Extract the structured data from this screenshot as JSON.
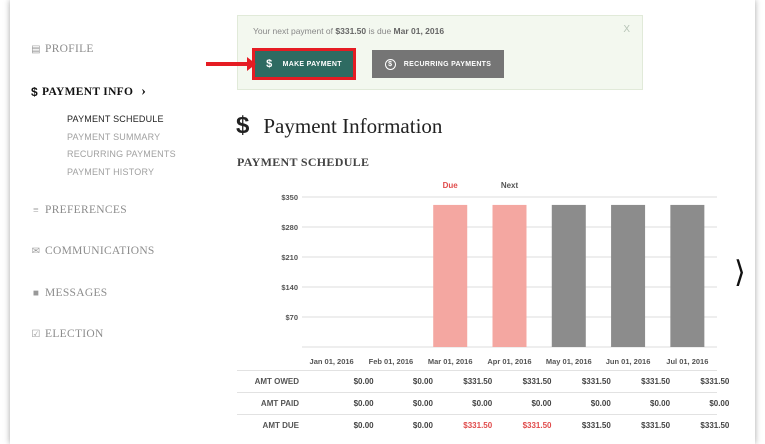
{
  "sidebar": {
    "items": [
      {
        "label": "PROFILE",
        "icon": "id-card-icon"
      },
      {
        "label": "PAYMENT INFO",
        "icon": "dollar-icon"
      },
      {
        "label": "PREFERENCES",
        "icon": "sliders-icon"
      },
      {
        "label": "COMMUNICATIONS",
        "icon": "envelope-icon"
      },
      {
        "label": "MESSAGES",
        "icon": "chat-icon"
      },
      {
        "label": "ELECTION",
        "icon": "checkbox-icon"
      }
    ],
    "subitems": [
      "PAYMENT SCHEDULE",
      "PAYMENT SUMMARY",
      "RECURRING PAYMENTS",
      "PAYMENT HISTORY"
    ]
  },
  "banner": {
    "text_prefix": "Your next payment of ",
    "amount": "$331.50",
    "text_mid": " is due ",
    "due_date": "Mar 01, 2016",
    "close": "X",
    "make_payment": "MAKE PAYMENT",
    "recurring": "RECURRING PAYMENTS"
  },
  "page": {
    "title": "Payment Information",
    "section": "PAYMENT SCHEDULE"
  },
  "colors": {
    "accent": "#2e6b62",
    "highlight": "#e51c23",
    "due_bar": "#f4a7a1",
    "future_bar": "#8c8c8c",
    "due_text": "#e04b4b"
  },
  "chart_data": {
    "type": "bar",
    "categories": [
      "Jan 01, 2016",
      "Feb 01, 2016",
      "Mar 01, 2016",
      "Apr 01, 2016",
      "May 01, 2016",
      "Jun 01, 2016",
      "Jul 01, 2016"
    ],
    "values": [
      0,
      0,
      331.5,
      331.5,
      331.5,
      331.5,
      331.5
    ],
    "status": [
      "",
      "",
      "due",
      "due",
      "future",
      "future",
      "future"
    ],
    "markers": {
      "2": "Due",
      "3": "Next"
    },
    "yticks": [
      "$350",
      "$280",
      "$210",
      "$140",
      "$70"
    ],
    "ytick_values": [
      350,
      280,
      210,
      140,
      70
    ],
    "ylim": [
      0,
      350
    ],
    "grid": true
  },
  "table": {
    "rows": [
      {
        "label": "AMT OWED",
        "values": [
          "$0.00",
          "$0.00",
          "$331.50",
          "$331.50",
          "$331.50",
          "$331.50",
          "$331.50"
        ],
        "red": []
      },
      {
        "label": "AMT PAID",
        "values": [
          "$0.00",
          "$0.00",
          "$0.00",
          "$0.00",
          "$0.00",
          "$0.00",
          "$0.00"
        ],
        "red": []
      },
      {
        "label": "AMT DUE",
        "values": [
          "$0.00",
          "$0.00",
          "$331.50",
          "$331.50",
          "$331.50",
          "$331.50",
          "$331.50"
        ],
        "red": [
          2,
          3
        ]
      }
    ]
  }
}
